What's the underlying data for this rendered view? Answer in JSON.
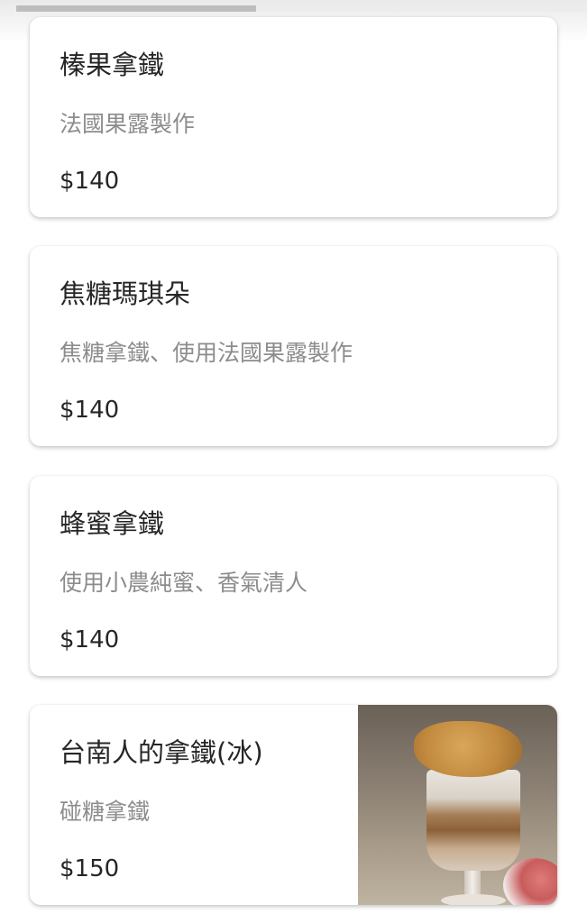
{
  "scrollbar": {
    "thumb_fraction": 0.42
  },
  "menu_items": [
    {
      "name": "榛果拿鐵",
      "description": "法國果露製作",
      "price": "$140"
    },
    {
      "name": "焦糖瑪琪朵",
      "description": "焦糖拿鐵、使用法國果露製作",
      "price": "$140"
    },
    {
      "name": "蜂蜜拿鐵",
      "description": "使用小農純蜜、香氣清人",
      "price": "$140"
    },
    {
      "name": "台南人的拿鐵(冰)",
      "description": "碰糖拿鐵",
      "price": "$150",
      "image": "iced-latte-photo"
    }
  ]
}
